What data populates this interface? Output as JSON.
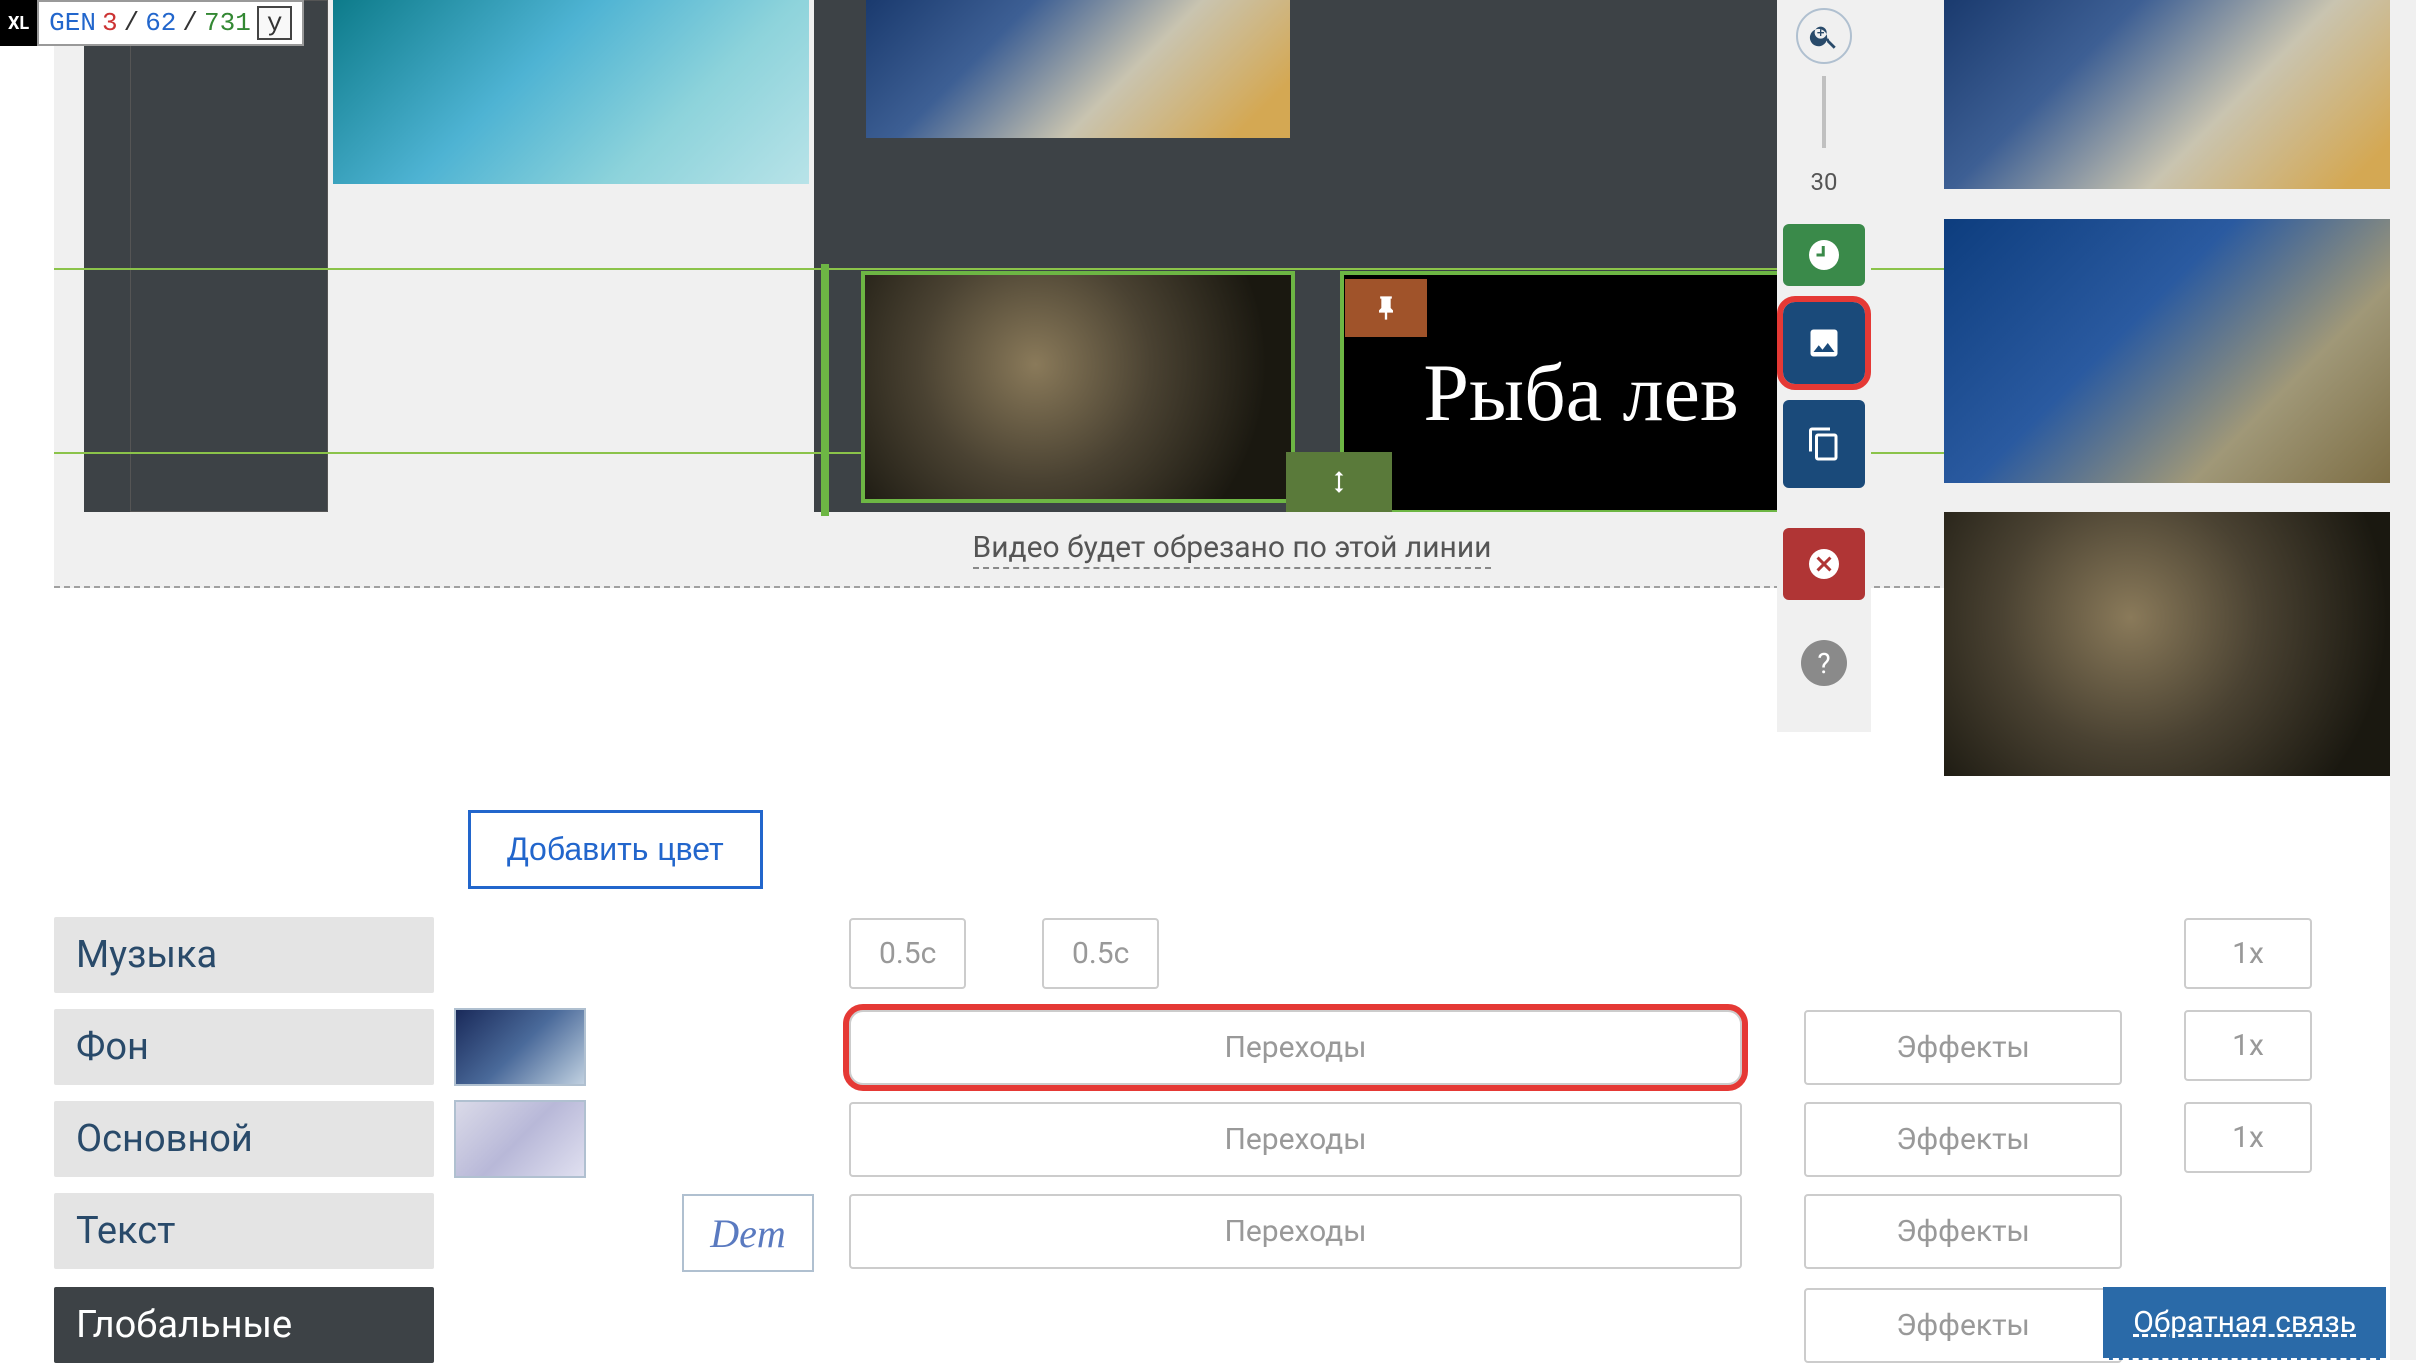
{
  "debug": {
    "xl": "XL",
    "gen_label": "GEN",
    "a": "3",
    "sep": "/",
    "b": "62",
    "c": "731",
    "flag": "y"
  },
  "canvas": {
    "title_clip_text": "Рыба лев",
    "trim_notice": "Видео будет обрезано по этой линии"
  },
  "zoom_value": "30",
  "lower": {
    "add_color": "Добавить цвет",
    "music": "Музыка",
    "background": "Фон",
    "main": "Основной",
    "text": "Текст",
    "global": "Глобальные",
    "dem_label": "Dem",
    "time1": "0.5с",
    "time2": "0.5с",
    "transitions": "Переходы",
    "effects": "Эффекты",
    "speed": "1x"
  },
  "feedback": "Обратная связь"
}
